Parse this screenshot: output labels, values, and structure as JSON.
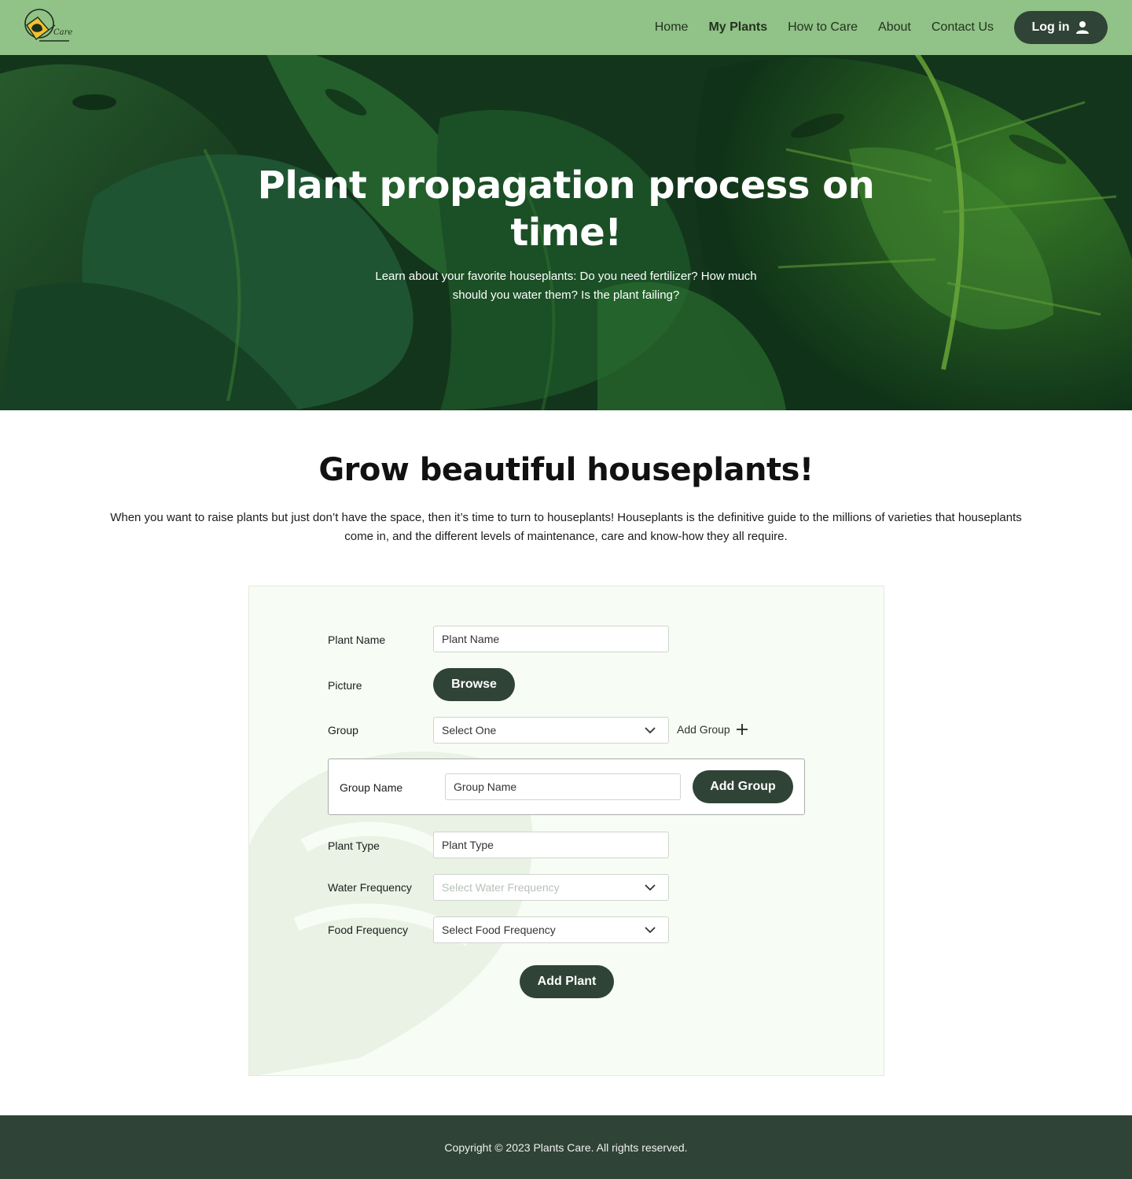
{
  "brand": {
    "logo_text": "Care"
  },
  "nav": {
    "items": [
      {
        "label": "Home",
        "active": false
      },
      {
        "label": "My Plants",
        "active": true
      },
      {
        "label": "How to Care",
        "active": false
      },
      {
        "label": "About",
        "active": false
      },
      {
        "label": "Contact Us",
        "active": false
      }
    ],
    "login_label": "Log in",
    "login_icon": "user-icon"
  },
  "hero": {
    "title": "Plant propagation process on time!",
    "subtitle": "Learn about your favorite houseplants: Do you need fertilizer? How much should you water them? Is the plant failing?"
  },
  "intro": {
    "title": "Grow beautiful houseplants!",
    "text": "When you want to raise plants but just don’t have the space, then it’s time to turn to houseplants! Houseplants is the definitive guide to the millions of varieties that houseplants come in, and the different levels of maintenance, care and know-how they all require."
  },
  "form": {
    "plant_name_label": "Plant Name",
    "plant_name_placeholder": "Plant Name",
    "picture_label": "Picture",
    "browse_label": "Browse",
    "group_label": "Group",
    "group_selected": "Select One",
    "add_group_link": "Add Group",
    "group_name_label": "Group Name",
    "group_name_placeholder": "Group Name",
    "add_group_button": "Add Group",
    "plant_type_label": "Plant Type",
    "plant_type_placeholder": "Plant Type",
    "water_label": "Water Frequency",
    "water_placeholder": "Select Water Frequency",
    "food_label": "Food Frequency",
    "food_selected": "Select Food Frequency",
    "submit_label": "Add Plant"
  },
  "footer": {
    "copyright": "Copyright © 2023 Plants Care. All rights reserved."
  },
  "colors": {
    "header": "#91c287",
    "dark": "#2f4336",
    "card": "#f7fcf4"
  }
}
